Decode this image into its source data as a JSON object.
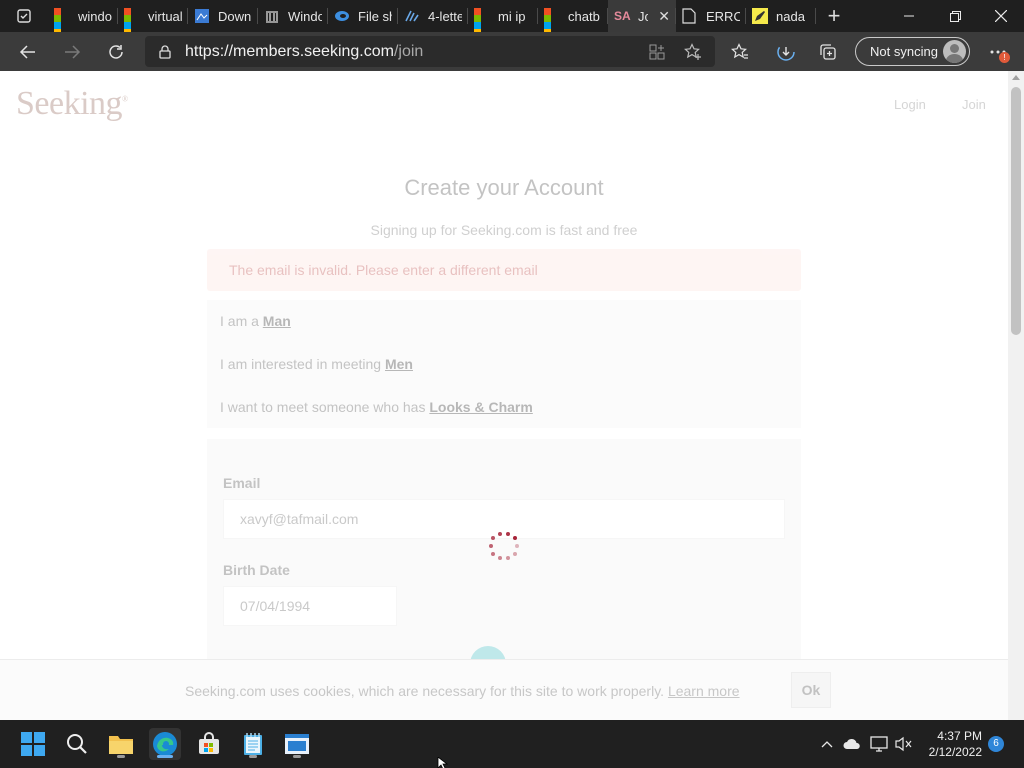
{
  "colors": {
    "accent": "#2f86d8",
    "error_bg": "#fde3df",
    "error_text": "#c0504d",
    "spinner": "#a0132a",
    "logo": "#c2a9a2"
  },
  "browser": {
    "tabs": [
      {
        "label": "windo",
        "icon": "microsoft-icon"
      },
      {
        "label": "virtual",
        "icon": "microsoft-icon"
      },
      {
        "label": "Down",
        "icon": "download-site-icon"
      },
      {
        "label": "Windo",
        "icon": "columns-icon"
      },
      {
        "label": "File sh",
        "icon": "edge-file-icon"
      },
      {
        "label": "4-lette",
        "icon": "bars-icon"
      },
      {
        "label": "mi ip",
        "icon": "microsoft-icon"
      },
      {
        "label": "chatb",
        "icon": "microsoft-icon"
      },
      {
        "label": "Jc",
        "icon": "seeking-icon",
        "active": true
      },
      {
        "label": "ERRO",
        "icon": "document-icon"
      },
      {
        "label": "nada",
        "icon": "yellow-pencil-icon"
      }
    ],
    "url_host": "https://members.seeking.com",
    "url_path": "/join",
    "sync_label": "Not syncing",
    "more_badge": "!"
  },
  "site": {
    "logo": "Seeking",
    "logo_mark": "®",
    "header_links": {
      "login": "Login",
      "join": "Join"
    }
  },
  "form": {
    "title": "Create your Account",
    "subtitle": "Signing up for Seeking.com is fast and free",
    "error": "The email is invalid. Please enter a different email",
    "pref_gender_prefix": "I am a ",
    "pref_gender_value": "Man",
    "pref_interest_prefix": "I am interested in meeting ",
    "pref_interest_value": "Men",
    "pref_trait_prefix": "I want to meet someone who has ",
    "pref_trait_value": "Looks & Charm",
    "email_label": "Email",
    "email_value": "xavyf@tafmail.com",
    "birth_label": "Birth Date",
    "birth_value": "07/04/1994"
  },
  "cookie": {
    "text": "Seeking.com uses cookies, which are necessary for this site to work properly.",
    "link": "Learn more",
    "ok": "Ok"
  },
  "taskbar": {
    "time": "4:37 PM",
    "date": "2/12/2022",
    "notification_count": "6"
  }
}
